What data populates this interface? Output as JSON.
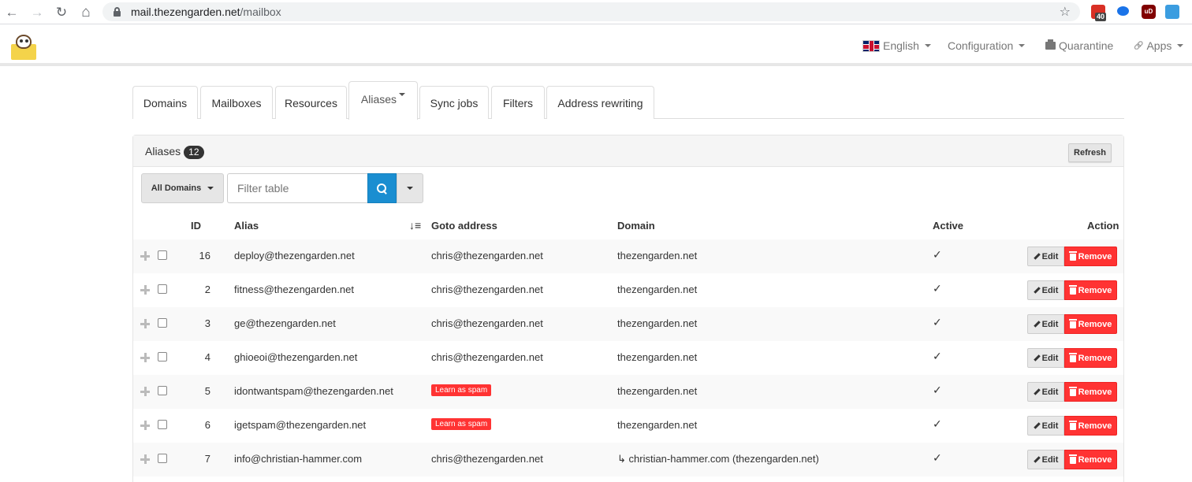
{
  "browser": {
    "url_host": "mail.thezengarden.net",
    "url_path": "/mailbox",
    "back_icon": "←",
    "forward_icon": "→",
    "reload_icon": "↻",
    "home_icon": "⌂",
    "star_icon": "☆",
    "ext_calendar_badge": "40",
    "ext_ublock_label": "uD"
  },
  "navbar": {
    "language": "English",
    "configuration": "Configuration",
    "quarantine": "Quarantine",
    "apps": "Apps",
    "apps_icon": "🔗"
  },
  "tabs": [
    {
      "label": "Domains"
    },
    {
      "label": "Mailboxes"
    },
    {
      "label": "Resources"
    },
    {
      "label": "Aliases"
    },
    {
      "label": "Sync jobs"
    },
    {
      "label": "Filters"
    },
    {
      "label": "Address rewriting"
    }
  ],
  "panel": {
    "title": "Aliases",
    "count": "12",
    "refresh_label": "Refresh"
  },
  "toolbar": {
    "domain_filter": "All Domains",
    "filter_placeholder": "Filter table"
  },
  "table": {
    "headers": {
      "id": "ID",
      "alias": "Alias",
      "goto": "Goto address",
      "domain": "Domain",
      "active": "Active",
      "action": "Action"
    },
    "sort_icon": "↓≡",
    "edit_label": "Edit",
    "remove_label": "Remove",
    "active_mark": "✓",
    "rows": [
      {
        "id": "16",
        "alias": "deploy@thezengarden.net",
        "goto": "chris@thezengarden.net",
        "goto_spam": "",
        "domain": "thezengarden.net"
      },
      {
        "id": "2",
        "alias": "fitness@thezengarden.net",
        "goto": "chris@thezengarden.net",
        "goto_spam": "",
        "domain": "thezengarden.net"
      },
      {
        "id": "3",
        "alias": "ge@thezengarden.net",
        "goto": "chris@thezengarden.net",
        "goto_spam": "",
        "domain": "thezengarden.net"
      },
      {
        "id": "4",
        "alias": "ghioeoi@thezengarden.net",
        "goto": "chris@thezengarden.net",
        "goto_spam": "",
        "domain": "thezengarden.net"
      },
      {
        "id": "5",
        "alias": "idontwantspam@thezengarden.net",
        "goto": "",
        "goto_spam": "Learn as spam",
        "domain": "thezengarden.net"
      },
      {
        "id": "6",
        "alias": "igetspam@thezengarden.net",
        "goto": "",
        "goto_spam": "Learn as spam",
        "domain": "thezengarden.net"
      },
      {
        "id": "7",
        "alias": "info@christian-hammer.com",
        "goto": "chris@thezengarden.net",
        "goto_spam": "",
        "domain": "↳ christian-hammer.com (thezengarden.net)"
      }
    ]
  }
}
